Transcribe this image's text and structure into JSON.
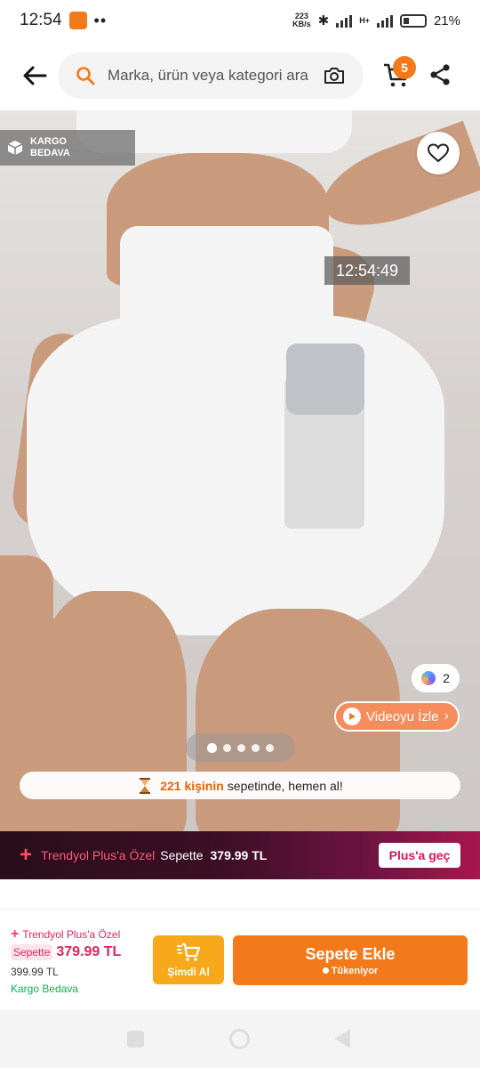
{
  "status_bar": {
    "time": "12:54",
    "net_speed_value": "223",
    "net_speed_unit": "KB/s",
    "network_type": "H+",
    "battery": "21",
    "battery_unit": "%"
  },
  "header": {
    "search_placeholder": "Marka, ürün veya kategori ara",
    "cart_count": "5"
  },
  "hero": {
    "cargo_label": "KARGO BEDAVA",
    "video_timestamp": "12:54:49",
    "color_count": "2",
    "video_button": "Videoyu İzle",
    "image_count": 5,
    "active_image": 1,
    "social_proof_count": "221 kişinin",
    "social_proof_text": "sepetinde, hemen al!"
  },
  "plus_banner": {
    "title": "Trendyol Plus'a Özel",
    "basket_label": "Sepette",
    "price": "379.99 TL",
    "cta": "Plus'a geç"
  },
  "bottom_bar": {
    "plus_brand": "Trendyol Plus'a Özel",
    "basket_label": "Sepette",
    "basket_price": "379.99 TL",
    "old_price": "399.99 TL",
    "shipping": "Kargo Bedava",
    "buy_now": "Şimdi Al",
    "add_to_cart": "Sepete Ekle",
    "stock_status": "Tükeniyor"
  },
  "colors": {
    "brand_orange": "#f27a1a",
    "plus_pink": "#e0245e",
    "shipping_green": "#0bb24a"
  }
}
